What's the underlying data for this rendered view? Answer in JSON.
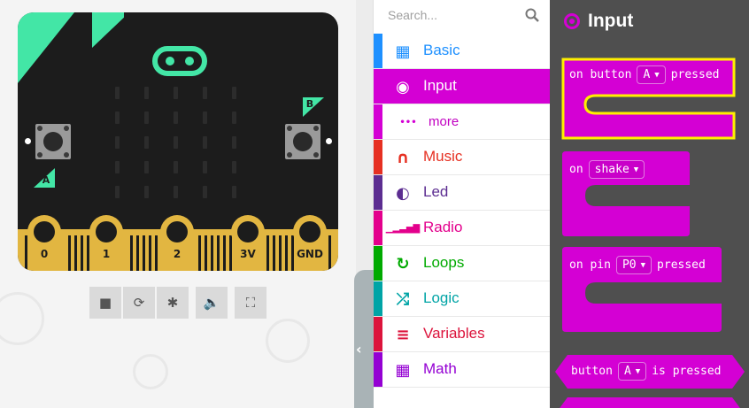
{
  "simulator": {
    "button_a_label": "A",
    "button_b_label": "B",
    "pins": [
      "0",
      "1",
      "2",
      "3V",
      "GND"
    ],
    "controls": [
      {
        "name": "stop-icon",
        "glyph": "■"
      },
      {
        "name": "restart-icon",
        "glyph": "⟳"
      },
      {
        "name": "debug-icon",
        "glyph": "✱"
      },
      {
        "name": "mute-icon",
        "glyph": "🔈"
      },
      {
        "name": "fullscreen-icon",
        "glyph": "⛶"
      }
    ],
    "colors": {
      "board": "#1c1c1c",
      "accent": "#43e6a6",
      "edge": "#e2b641"
    }
  },
  "toolbox": {
    "search_placeholder": "Search...",
    "collapse_glyph": "‹",
    "categories": [
      {
        "label": "Basic",
        "icon": "grid-icon",
        "glyph": "▦",
        "color": "#1e90ff"
      },
      {
        "label": "Input",
        "icon": "target-icon",
        "glyph": "◉",
        "color": "#d400d4",
        "selected": true
      },
      {
        "label": "more",
        "icon": "dots-icon",
        "glyph": "•••",
        "color": "#d400d4",
        "sub": true
      },
      {
        "label": "Music",
        "icon": "headphones-icon",
        "glyph": "∩",
        "color": "#e63022"
      },
      {
        "label": "Led",
        "icon": "toggle-icon",
        "glyph": "◐",
        "color": "#5c2d91"
      },
      {
        "label": "Radio",
        "icon": "signal-bars-icon",
        "glyph": "▁▂▃▅▇",
        "color": "#e3008c"
      },
      {
        "label": "Loops",
        "icon": "refresh-icon",
        "glyph": "↻",
        "color": "#00aa00"
      },
      {
        "label": "Logic",
        "icon": "shuffle-icon",
        "glyph": "⤮",
        "color": "#00a4a6"
      },
      {
        "label": "Variables",
        "icon": "lines-icon",
        "glyph": "≡",
        "color": "#dc143c"
      },
      {
        "label": "Math",
        "icon": "calculator-icon",
        "glyph": "▦",
        "color": "#9400d3"
      }
    ]
  },
  "flyout": {
    "title": "Input",
    "color": "#d400d4",
    "blocks": [
      {
        "id": "on-button-pressed",
        "parts": [
          "on button",
          "A",
          "pressed"
        ]
      },
      {
        "id": "on-shake",
        "parts": [
          "on",
          "shake"
        ]
      },
      {
        "id": "on-pin-pressed",
        "parts": [
          "on pin",
          "P0",
          "pressed"
        ]
      },
      {
        "id": "button-is-pressed",
        "parts": [
          "button",
          "A",
          "is pressed"
        ]
      }
    ]
  }
}
